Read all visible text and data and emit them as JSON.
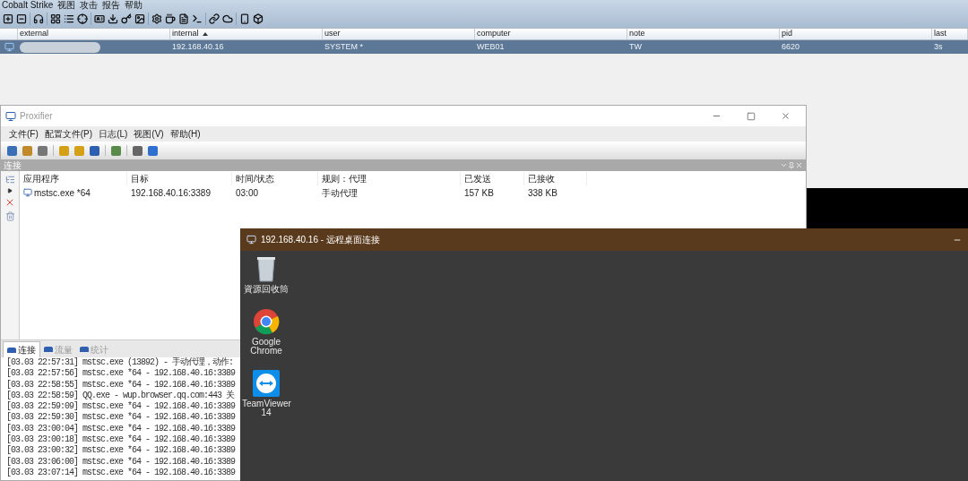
{
  "cobalt_strike": {
    "menu": [
      "Cobalt Strike",
      "视图",
      "攻击",
      "报告",
      "帮助"
    ],
    "table": {
      "columns": [
        {
          "label": "external",
          "sorted": false
        },
        {
          "label": "internal",
          "sorted": true
        },
        {
          "label": "user",
          "sorted": false
        },
        {
          "label": "computer",
          "sorted": false
        },
        {
          "label": "note",
          "sorted": false
        },
        {
          "label": "pid",
          "sorted": false
        },
        {
          "label": "last",
          "sorted": false
        }
      ],
      "rows": [
        {
          "selected": true,
          "external_blurred": true,
          "cells": [
            "",
            "192.168.40.16",
            "SYSTEM *",
            "WEB01",
            "TW",
            "6620",
            "3s"
          ]
        }
      ]
    }
  },
  "proxifier": {
    "title": "Proxifier",
    "menu": [
      "文件(F)",
      "配置文件(P)",
      "日志(L)",
      "视图(V)",
      "帮助(H)"
    ],
    "panel_title": "连接",
    "columns": [
      "应用程序",
      "目标",
      "时间/状态",
      "规则：代理",
      "已发送",
      "已接收"
    ],
    "rows": [
      {
        "cells": [
          "mstsc.exe *64",
          "192.168.40.16:3389",
          "03:00",
          "手动代理",
          "157 KB",
          "338 KB"
        ]
      }
    ],
    "tabs": [
      {
        "label": "连接",
        "selected": true
      },
      {
        "label": "流量",
        "selected": false
      },
      {
        "label": "统计",
        "selected": false
      }
    ],
    "log": [
      "[03.03 22:57:31] mstsc.exe (13892) - 手动代理，动作:",
      "[03.03 22:57:56] mstsc.exe *64 - 192.168.40.16:3389",
      "[03.03 22:58:55] mstsc.exe *64 - 192.168.40.16:3389",
      "[03.03 22:58:59] QQ.exe - wup.browser.qq.com:443 关",
      "[03.03 22:59:09] mstsc.exe *64 - 192.168.40.16:3389",
      "[03.03 22:59:30] mstsc.exe *64 - 192.168.40.16:3389",
      "[03.03 23:00:04] mstsc.exe *64 - 192.168.40.16:3389",
      "[03.03 23:00:18] mstsc.exe *64 - 192.168.40.16:3389",
      "[03.03 23:00:32] mstsc.exe *64 - 192.168.40.16:3389",
      "[03.03 23:06:00] mstsc.exe *64 - 192.168.40.16:3389",
      "[03.03 23:07:14] mstsc.exe *64 - 192.168.40.16:3389"
    ]
  },
  "remote_desktop": {
    "title": "192.168.40.16 - 远程桌面连接",
    "desktop_icons": [
      {
        "kind": "recycle_bin",
        "label": "資源回收筒"
      },
      {
        "kind": "chrome",
        "label": "Google Chrome"
      },
      {
        "kind": "teamviewer",
        "label": "TeamViewer 14"
      }
    ]
  }
}
